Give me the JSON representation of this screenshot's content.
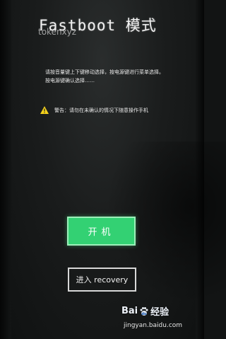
{
  "title": "Fastboot 模式",
  "watermark_top": "tokenxyz",
  "instructions": [
    "请按音量键上下键移动选择，按电源键进行菜单选择。",
    "按电源键确认选择……"
  ],
  "warning_text": "警告：请勿在未确认的情况下随意操作手机",
  "buttons": {
    "boot_label": "开机",
    "recovery_label": "进入 recovery"
  },
  "baidu": {
    "logo_text_a": "Bai",
    "logo_text_b": "经验",
    "url": "jingyan.baidu.com"
  },
  "colors": {
    "boot_button": "#33d173",
    "warning_icon": "#f5d21b"
  },
  "icons": {
    "warning": "warning-triangle",
    "watermark": "baidu-paw"
  }
}
